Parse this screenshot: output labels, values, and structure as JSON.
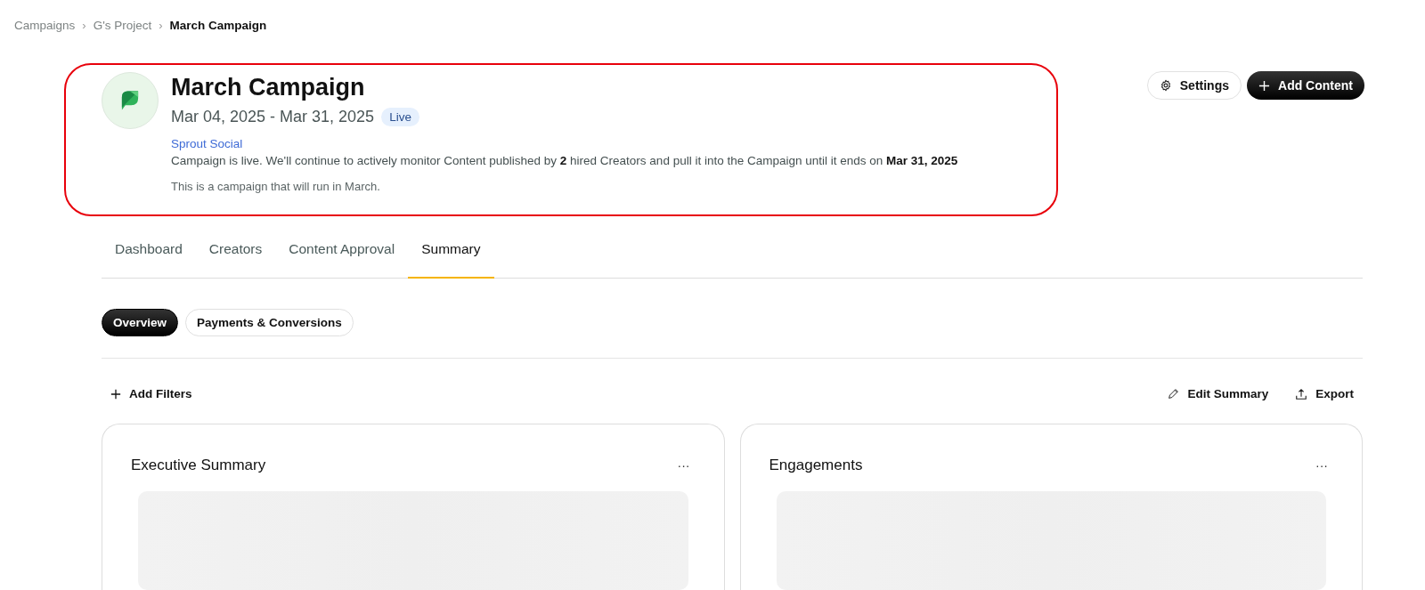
{
  "breadcrumbs": [
    {
      "label": "Campaigns",
      "current": false
    },
    {
      "label": "G's Project",
      "current": false
    },
    {
      "label": "March Campaign",
      "current": true
    }
  ],
  "breadcrumb_separator": "›",
  "campaign": {
    "title": "March Campaign",
    "dates": "Mar 04, 2025 - Mar 31, 2025",
    "status": "Live",
    "brand": "Sprout Social",
    "description": "Campaign is live. We'll continue to actively monitor Content published by **2** hired Creators and pull it into the Campaign until it ends on **Mar 31, 2025**",
    "note": "This is a campaign that will run in March.",
    "highlighted": true
  },
  "actions": [
    {
      "label": "Settings",
      "kind": "secondary"
    },
    {
      "label": "Add Content",
      "kind": "primary"
    }
  ],
  "tabs": [
    {
      "label": "Dashboard",
      "selected": false
    },
    {
      "label": "Creators",
      "selected": false
    },
    {
      "label": "Content Approval",
      "selected": false
    },
    {
      "label": "Summary",
      "selected": true
    }
  ],
  "subtabs": [
    {
      "label": "Overview",
      "selected": true
    },
    {
      "label": "Payments & Conversions",
      "selected": false
    }
  ],
  "toolbar": {
    "filters": "Add Filters",
    "edit": "Edit Summary",
    "export": "Export"
  },
  "cards": [
    {
      "title": "Executive Summary",
      "menu": "···"
    },
    {
      "title": "Engagements",
      "menu": "···"
    }
  ]
}
